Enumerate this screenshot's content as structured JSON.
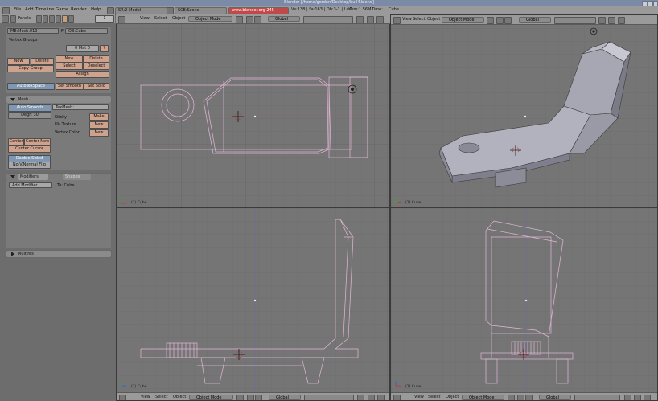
{
  "window": {
    "title": "Blender [/home/gordon/Desktop/bull4.blend]"
  },
  "top_header": {
    "menus": [
      "File",
      "Add",
      "Timeline",
      "Game",
      "Render",
      "Help"
    ],
    "screen": "SR:2-Model",
    "scene": "SCE:Scene",
    "url": "www.blender.org 245",
    "stats": "Ve:138 | Fa:163 | Ob:3-1 | La:1",
    "mem": "Mem:1.56M",
    "time": "Time:",
    "object": "Cube"
  },
  "buttons_window": {
    "header": {
      "panels_label": "Panels",
      "frame": "1"
    },
    "link_materials": {
      "me_field": "ME:Mesh.010",
      "f_label": "F",
      "ob_field": "OB:Cube",
      "vertex_groups_label": "Vertex Groups",
      "mat_field": "0 Mat 0",
      "question": "?",
      "new_label": "New",
      "delete_label": "Delete",
      "copy_group_label": "Copy Group",
      "mat_new": "New",
      "mat_delete": "Delete",
      "select": "Select",
      "deselect": "Deselect",
      "assign": "Assign",
      "autotexspace": "AutoTexSpace",
      "set_smooth": "Set Smooth",
      "set_solid": "Set Solid"
    },
    "mesh_panel": {
      "title": "Mesh",
      "auto_smooth": "Auto Smooth",
      "texmesh": "TexMesh:",
      "degr": "Degr: 30",
      "sticky": "Sticky",
      "make": "Make",
      "uv_texture": "UV Texture",
      "uv_new": "New",
      "vertex_color": "Vertex Color",
      "vc_new": "New",
      "center": "Center",
      "center_new": "Center New",
      "center_cursor": "Center Cursor",
      "double_sided": "Double Sided",
      "no_v_normal_flip": "No V.Normal Flip"
    },
    "modifiers_panel": {
      "tab_modifiers": "Modifiers",
      "tab_shapes": "Shapes",
      "add_modifier": "Add Modifier",
      "to_label": "To: Cube"
    },
    "multires_panel": {
      "title": "Multires"
    }
  },
  "viewports": [
    {
      "id": "top-left",
      "label": "(1) Cube"
    },
    {
      "id": "top-right",
      "label": "(1) Cube"
    },
    {
      "id": "bottom-left",
      "label": "(1) Cube"
    },
    {
      "id": "bottom-right",
      "label": "(1) Cube"
    }
  ],
  "viewport_header": {
    "view": "View",
    "select": "Select",
    "object": "Object",
    "mode": "Object Mode",
    "orientation": "Global"
  },
  "colors": {
    "wire": "#e4b8d8",
    "grid": "#6a6a6a",
    "bg": "#757575",
    "header": "#9a9a9a",
    "cursor": "#cc3333"
  }
}
